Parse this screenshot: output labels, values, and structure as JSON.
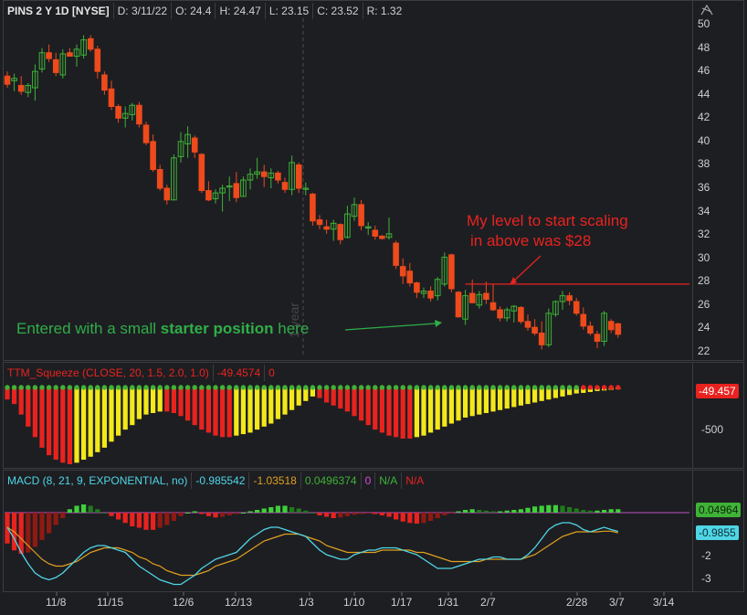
{
  "header": {
    "symbol": "PINS 2 Y 1D [NYSE]",
    "date": "D: 3/11/22",
    "open": "O: 24.4",
    "high": "H: 24.47",
    "low": "L: 23.15",
    "close": "C: 23.52",
    "range": "R: 1.32"
  },
  "ttm": {
    "title": "TTM_Squeeze (CLOSE, 20, 1.5, 2.0, 1.0)",
    "value": "-49.4574",
    "signal": "0",
    "last_label": "-49.457",
    "tick_label": "-500"
  },
  "macd": {
    "title": "MACD (8, 21, 9, EXPONENTIAL, no)",
    "v1": "-0.985542",
    "v2": "-1.03518",
    "v3": "0.0496374",
    "v4": "0",
    "v5": "N/A",
    "v6": "N/A",
    "hist_label": "0.04964",
    "line_label": "-0.9855",
    "ticks": [
      "-2",
      "-3"
    ]
  },
  "price_ticks": [
    "50",
    "48",
    "46",
    "44",
    "42",
    "40",
    "38",
    "36",
    "34",
    "32",
    "30",
    "28",
    "26",
    "24",
    "22"
  ],
  "x_ticks": [
    "11/8",
    "11/15",
    "12/6",
    "12/13",
    "1/3",
    "1/10",
    "1/17",
    "1/31",
    "2/7",
    "2/28",
    "3/7",
    "3/14"
  ],
  "watermark": "1 year",
  "annotations": {
    "level_line1": "My level to start scaling",
    "level_line2": "in above was $28",
    "entry_prefix": "Entered with a  small ",
    "entry_bold": "starter position",
    "entry_suffix": " here"
  },
  "colors": {
    "up": "#3fb237",
    "down": "#ee4a1c",
    "annotation_red": "#e8231f",
    "annotation_green": "#2fae48",
    "macd_line": "#4fd6e6",
    "signal_line": "#e0a020"
  },
  "chart_data": {
    "type": "candlestick",
    "ylim": [
      21,
      51
    ],
    "candles": [
      {
        "o": 45.6,
        "h": 46.0,
        "l": 44.6,
        "c": 44.9
      },
      {
        "o": 45.2,
        "h": 45.8,
        "l": 44.3,
        "c": 45.4
      },
      {
        "o": 44.8,
        "h": 45.6,
        "l": 44.0,
        "c": 44.3
      },
      {
        "o": 44.2,
        "h": 45.0,
        "l": 43.8,
        "c": 44.8
      },
      {
        "o": 44.6,
        "h": 46.6,
        "l": 43.5,
        "c": 46.0
      },
      {
        "o": 46.2,
        "h": 48.0,
        "l": 45.9,
        "c": 47.6
      },
      {
        "o": 47.6,
        "h": 48.3,
        "l": 46.8,
        "c": 47.1
      },
      {
        "o": 47.0,
        "h": 47.6,
        "l": 45.6,
        "c": 45.9
      },
      {
        "o": 45.7,
        "h": 47.9,
        "l": 45.4,
        "c": 47.5
      },
      {
        "o": 47.6,
        "h": 48.0,
        "l": 47.3,
        "c": 47.3
      },
      {
        "o": 47.3,
        "h": 48.3,
        "l": 46.4,
        "c": 47.9
      },
      {
        "o": 47.4,
        "h": 49.1,
        "l": 47.1,
        "c": 48.7
      },
      {
        "o": 48.8,
        "h": 49.1,
        "l": 47.7,
        "c": 47.9
      },
      {
        "o": 47.9,
        "h": 48.2,
        "l": 45.4,
        "c": 46.0
      },
      {
        "o": 45.7,
        "h": 46.0,
        "l": 44.0,
        "c": 44.4
      },
      {
        "o": 44.5,
        "h": 45.2,
        "l": 42.7,
        "c": 43.0
      },
      {
        "o": 43.0,
        "h": 43.2,
        "l": 41.6,
        "c": 42.0
      },
      {
        "o": 42.0,
        "h": 43.0,
        "l": 41.2,
        "c": 42.4
      },
      {
        "o": 42.3,
        "h": 43.3,
        "l": 41.8,
        "c": 43.1
      },
      {
        "o": 43.1,
        "h": 43.4,
        "l": 41.2,
        "c": 41.5
      },
      {
        "o": 41.4,
        "h": 41.7,
        "l": 39.7,
        "c": 39.9
      },
      {
        "o": 40.0,
        "h": 40.6,
        "l": 37.4,
        "c": 37.6
      },
      {
        "o": 37.6,
        "h": 38.0,
        "l": 35.8,
        "c": 36.0
      },
      {
        "o": 36.0,
        "h": 36.3,
        "l": 34.6,
        "c": 35.0
      },
      {
        "o": 35.0,
        "h": 38.9,
        "l": 35.0,
        "c": 38.6
      },
      {
        "o": 38.7,
        "h": 40.8,
        "l": 38.2,
        "c": 40.0
      },
      {
        "o": 39.8,
        "h": 41.3,
        "l": 38.6,
        "c": 40.6
      },
      {
        "o": 40.3,
        "h": 40.5,
        "l": 38.6,
        "c": 39.1
      },
      {
        "o": 38.9,
        "h": 39.0,
        "l": 35.6,
        "c": 35.8
      },
      {
        "o": 35.8,
        "h": 36.6,
        "l": 34.9,
        "c": 35.0
      },
      {
        "o": 35.1,
        "h": 35.9,
        "l": 34.7,
        "c": 35.6
      },
      {
        "o": 35.6,
        "h": 36.3,
        "l": 34.0,
        "c": 36.0
      },
      {
        "o": 36.1,
        "h": 37.0,
        "l": 34.9,
        "c": 36.2
      },
      {
        "o": 36.4,
        "h": 37.4,
        "l": 34.8,
        "c": 35.2
      },
      {
        "o": 35.3,
        "h": 37.0,
        "l": 35.3,
        "c": 36.7
      },
      {
        "o": 36.7,
        "h": 37.7,
        "l": 35.9,
        "c": 37.2
      },
      {
        "o": 37.2,
        "h": 38.6,
        "l": 36.8,
        "c": 37.4
      },
      {
        "o": 37.4,
        "h": 38.0,
        "l": 36.1,
        "c": 37.0
      },
      {
        "o": 36.9,
        "h": 37.7,
        "l": 36.0,
        "c": 37.3
      },
      {
        "o": 37.3,
        "h": 37.5,
        "l": 36.4,
        "c": 36.7
      },
      {
        "o": 36.5,
        "h": 36.9,
        "l": 35.6,
        "c": 35.9
      },
      {
        "o": 35.9,
        "h": 38.8,
        "l": 35.4,
        "c": 38.2
      },
      {
        "o": 38.0,
        "h": 38.2,
        "l": 35.6,
        "c": 36.0
      },
      {
        "o": 35.9,
        "h": 36.5,
        "l": 35.4,
        "c": 36.0
      },
      {
        "o": 35.5,
        "h": 35.6,
        "l": 32.8,
        "c": 33.2
      },
      {
        "o": 33.3,
        "h": 33.7,
        "l": 32.5,
        "c": 32.9
      },
      {
        "o": 32.7,
        "h": 33.3,
        "l": 32.1,
        "c": 32.5
      },
      {
        "o": 32.5,
        "h": 33.3,
        "l": 31.5,
        "c": 33.0
      },
      {
        "o": 32.9,
        "h": 33.0,
        "l": 31.2,
        "c": 31.6
      },
      {
        "o": 31.8,
        "h": 34.5,
        "l": 31.7,
        "c": 33.8
      },
      {
        "o": 33.6,
        "h": 35.2,
        "l": 33.2,
        "c": 34.6
      },
      {
        "o": 34.6,
        "h": 35.0,
        "l": 32.4,
        "c": 32.8
      },
      {
        "o": 32.6,
        "h": 33.1,
        "l": 32.0,
        "c": 32.7
      },
      {
        "o": 32.4,
        "h": 32.8,
        "l": 31.6,
        "c": 31.9
      },
      {
        "o": 31.9,
        "h": 32.0,
        "l": 31.6,
        "c": 31.7
      },
      {
        "o": 31.8,
        "h": 33.5,
        "l": 31.6,
        "c": 32.1
      },
      {
        "o": 31.3,
        "h": 31.5,
        "l": 29.1,
        "c": 29.4
      },
      {
        "o": 29.3,
        "h": 30.0,
        "l": 27.8,
        "c": 28.5
      },
      {
        "o": 28.9,
        "h": 29.6,
        "l": 27.6,
        "c": 27.9
      },
      {
        "o": 27.9,
        "h": 28.0,
        "l": 26.6,
        "c": 27.1
      },
      {
        "o": 27.0,
        "h": 27.5,
        "l": 26.6,
        "c": 27.2
      },
      {
        "o": 27.2,
        "h": 27.6,
        "l": 26.3,
        "c": 26.6
      },
      {
        "o": 26.8,
        "h": 28.4,
        "l": 26.4,
        "c": 28.2
      },
      {
        "o": 27.8,
        "h": 30.5,
        "l": 27.6,
        "c": 30.1
      },
      {
        "o": 30.3,
        "h": 30.4,
        "l": 27.1,
        "c": 27.4
      },
      {
        "o": 27.1,
        "h": 27.2,
        "l": 24.9,
        "c": 25.0
      },
      {
        "o": 24.8,
        "h": 27.3,
        "l": 24.3,
        "c": 26.8
      },
      {
        "o": 27.0,
        "h": 28.2,
        "l": 26.6,
        "c": 26.2
      },
      {
        "o": 26.0,
        "h": 27.2,
        "l": 25.7,
        "c": 26.9
      },
      {
        "o": 27.0,
        "h": 28.0,
        "l": 26.1,
        "c": 26.5
      },
      {
        "o": 26.2,
        "h": 27.8,
        "l": 25.5,
        "c": 25.6
      },
      {
        "o": 25.6,
        "h": 25.9,
        "l": 24.6,
        "c": 24.9
      },
      {
        "o": 24.9,
        "h": 25.8,
        "l": 24.6,
        "c": 25.6
      },
      {
        "o": 25.5,
        "h": 26.0,
        "l": 24.5,
        "c": 25.9
      },
      {
        "o": 25.8,
        "h": 25.9,
        "l": 24.4,
        "c": 24.6
      },
      {
        "o": 24.6,
        "h": 25.2,
        "l": 23.8,
        "c": 24.1
      },
      {
        "o": 24.1,
        "h": 24.8,
        "l": 23.4,
        "c": 23.6
      },
      {
        "o": 23.6,
        "h": 24.6,
        "l": 22.2,
        "c": 22.6
      },
      {
        "o": 22.6,
        "h": 25.7,
        "l": 22.4,
        "c": 25.3
      },
      {
        "o": 25.2,
        "h": 26.4,
        "l": 25.0,
        "c": 26.3
      },
      {
        "o": 26.3,
        "h": 27.2,
        "l": 25.6,
        "c": 26.8
      },
      {
        "o": 26.8,
        "h": 27.1,
        "l": 26.0,
        "c": 26.4
      },
      {
        "o": 26.3,
        "h": 26.6,
        "l": 25.1,
        "c": 25.3
      },
      {
        "o": 25.2,
        "h": 25.8,
        "l": 23.9,
        "c": 24.2
      },
      {
        "o": 24.2,
        "h": 24.6,
        "l": 23.4,
        "c": 23.6
      },
      {
        "o": 23.5,
        "h": 23.8,
        "l": 22.3,
        "c": 22.9
      },
      {
        "o": 22.9,
        "h": 25.5,
        "l": 22.5,
        "c": 25.3
      },
      {
        "o": 24.6,
        "h": 24.8,
        "l": 23.6,
        "c": 23.9
      },
      {
        "o": 24.4,
        "h": 24.5,
        "l": 23.2,
        "c": 23.5
      }
    ],
    "level": 27.8,
    "squeeze": [
      -40,
      -55,
      -90,
      -130,
      -165,
      -200,
      -225,
      -240,
      -250,
      -255,
      -250,
      -240,
      -230,
      -215,
      -200,
      -180,
      -160,
      -140,
      -125,
      -105,
      -90,
      -85,
      -80,
      -80,
      -85,
      -95,
      -110,
      -125,
      -140,
      -150,
      -160,
      -165,
      -165,
      -160,
      -155,
      -150,
      -140,
      -130,
      -120,
      -105,
      -90,
      -75,
      -60,
      -45,
      -30,
      -35,
      -50,
      -60,
      -70,
      -80,
      -95,
      -110,
      -125,
      -140,
      -150,
      -160,
      -165,
      -170,
      -170,
      -165,
      -160,
      -150,
      -140,
      -130,
      -120,
      -110,
      -100,
      -95,
      -90,
      -85,
      -80,
      -75,
      -70,
      -65,
      -60,
      -55,
      -50,
      -45,
      -40,
      -35,
      -30,
      -25,
      -20,
      -18,
      -15,
      -12,
      -10,
      -8,
      -6
    ],
    "macd_hist": [
      -0.45,
      -0.55,
      -0.6,
      -0.58,
      -0.5,
      -0.4,
      -0.3,
      -0.18,
      -0.08,
      0.05,
      0.1,
      0.12,
      0.1,
      0.05,
      0.0,
      -0.05,
      -0.1,
      -0.15,
      -0.2,
      -0.22,
      -0.25,
      -0.25,
      -0.22,
      -0.18,
      -0.12,
      -0.05,
      0.0,
      0.02,
      -0.02,
      -0.05,
      -0.07,
      -0.06,
      -0.04,
      -0.02,
      0.0,
      0.02,
      0.04,
      0.06,
      0.08,
      0.1,
      0.1,
      0.08,
      0.06,
      0.03,
      0.0,
      -0.04,
      -0.06,
      -0.08,
      -0.07,
      -0.05,
      -0.03,
      -0.02,
      -0.01,
      -0.02,
      -0.04,
      -0.06,
      -0.1,
      -0.13,
      -0.15,
      -0.16,
      -0.15,
      -0.12,
      -0.08,
      -0.04,
      -0.01,
      0.02,
      0.04,
      0.05,
      0.04,
      0.03,
      0.02,
      0.02,
      0.03,
      0.04,
      0.05,
      0.07,
      0.09,
      0.1,
      0.11,
      0.11,
      0.1,
      0.08,
      0.06,
      0.04,
      0.03,
      0.03,
      0.04,
      0.05,
      0.05
    ],
    "macd_line": [
      -0.8,
      -1.3,
      -1.9,
      -2.4,
      -2.8,
      -3.0,
      -3.1,
      -3.0,
      -2.8,
      -2.5,
      -2.2,
      -1.9,
      -1.7,
      -1.6,
      -1.6,
      -1.7,
      -1.8,
      -1.9,
      -2.2,
      -2.5,
      -2.7,
      -2.9,
      -3.1,
      -3.2,
      -3.3,
      -3.3,
      -3.1,
      -2.9,
      -2.6,
      -2.4,
      -2.2,
      -2.1,
      -2.0,
      -1.9,
      -1.6,
      -1.3,
      -1.1,
      -0.9,
      -0.8,
      -0.8,
      -0.9,
      -1.0,
      -1.1,
      -1.2,
      -1.5,
      -1.8,
      -2.0,
      -2.1,
      -2.2,
      -2.2,
      -2.0,
      -1.9,
      -1.8,
      -1.8,
      -1.7,
      -1.7,
      -1.7,
      -1.8,
      -1.9,
      -2.0,
      -2.2,
      -2.4,
      -2.6,
      -2.6,
      -2.6,
      -2.5,
      -2.4,
      -2.3,
      -2.2,
      -2.2,
      -2.1,
      -2.1,
      -2.2,
      -2.2,
      -2.2,
      -2.0,
      -1.7,
      -1.3,
      -0.9,
      -0.7,
      -0.6,
      -0.6,
      -0.7,
      -0.9,
      -1.0,
      -0.9,
      -0.8,
      -0.9,
      -0.98
    ],
    "signal_line": [
      -0.8,
      -1.0,
      -1.3,
      -1.6,
      -1.9,
      -2.2,
      -2.4,
      -2.5,
      -2.5,
      -2.4,
      -2.3,
      -2.1,
      -1.9,
      -1.8,
      -1.7,
      -1.7,
      -1.7,
      -1.8,
      -1.9,
      -2.1,
      -2.2,
      -2.4,
      -2.5,
      -2.7,
      -2.8,
      -2.9,
      -2.9,
      -2.9,
      -2.8,
      -2.7,
      -2.5,
      -2.4,
      -2.3,
      -2.2,
      -2.0,
      -1.8,
      -1.6,
      -1.4,
      -1.3,
      -1.2,
      -1.1,
      -1.1,
      -1.1,
      -1.2,
      -1.3,
      -1.4,
      -1.6,
      -1.7,
      -1.8,
      -1.9,
      -1.9,
      -1.9,
      -1.9,
      -1.9,
      -1.8,
      -1.8,
      -1.8,
      -1.8,
      -1.8,
      -1.9,
      -1.9,
      -2.0,
      -2.1,
      -2.2,
      -2.3,
      -2.3,
      -2.3,
      -2.3,
      -2.3,
      -2.2,
      -2.2,
      -2.2,
      -2.2,
      -2.2,
      -2.2,
      -2.1,
      -2.0,
      -1.8,
      -1.6,
      -1.4,
      -1.2,
      -1.1,
      -1.0,
      -1.0,
      -1.0,
      -1.0,
      -0.97,
      -0.97,
      -1.04
    ]
  }
}
